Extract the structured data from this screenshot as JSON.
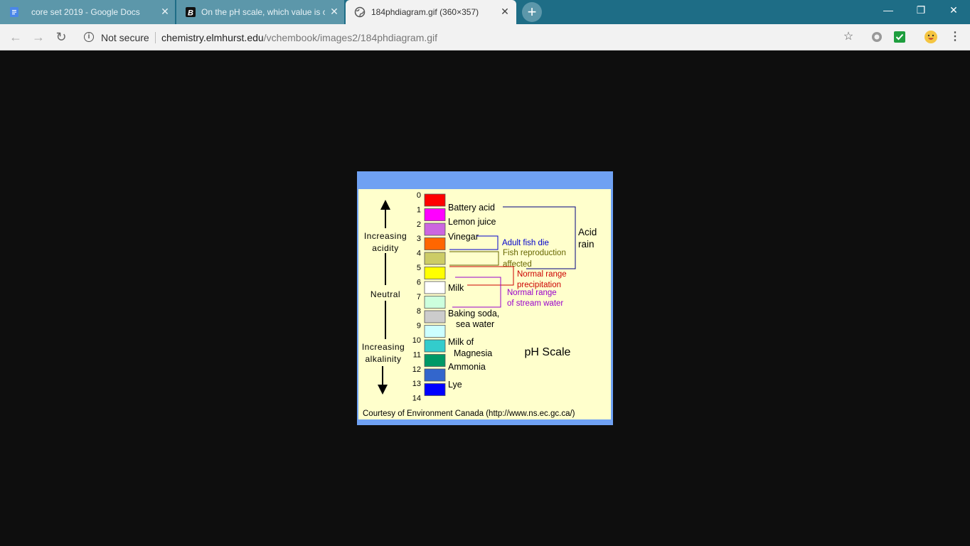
{
  "tabs": [
    {
      "title": "core set 2019 - Google Docs",
      "favicon": "google-docs-icon",
      "state": "background"
    },
    {
      "title": "On the pH scale, which value is c",
      "favicon": "brainly-icon",
      "state": "background"
    },
    {
      "title": "184phdiagram.gif (360×357)",
      "favicon": "globe-icon",
      "state": "active"
    }
  ],
  "toolbar": {
    "security_text": "Not secure",
    "url_host": "chemistry.elmhurst.edu",
    "url_path": "/vchembook/images2/184phdiagram.gif"
  },
  "diagram": {
    "title": "pH Scale",
    "ph_numbers": [
      "0",
      "1",
      "2",
      "3",
      "4",
      "5",
      "6",
      "7",
      "8",
      "9",
      "10",
      "11",
      "12",
      "13",
      "14"
    ],
    "swatch_colors": [
      "#ff0000",
      "#ff00ff",
      "#cc66e0",
      "#ff6600",
      "#cccc66",
      "#ffff00",
      "#ffffff",
      "#ccffdd",
      "#cccccc",
      "#ccffff",
      "#33cccc",
      "#009966",
      "#3366cc",
      "#0000ff"
    ],
    "substances": {
      "battery_acid": "Battery acid",
      "lemon_juice": "Lemon juice",
      "vinegar": "Vinegar",
      "milk": "Milk",
      "baking_soda_1": "Baking soda,",
      "baking_soda_2": "sea water",
      "milk_of_magnesia_1": "Milk of",
      "milk_of_magnesia_2": "Magnesia",
      "ammonia": "Ammonia",
      "lye": "Lye"
    },
    "axis_labels": {
      "acidity_1": "Increasing",
      "acidity_2": "acidity",
      "neutral": "Neutral",
      "alkalinity_1": "Increasing",
      "alkalinity_2": "alkalinity"
    },
    "ranges": {
      "acid_rain_1": "Acid",
      "acid_rain_2": "rain",
      "fish_die": "Adult fish die",
      "fish_repro_1": "Fish reproduction",
      "fish_repro_2": "affected",
      "precip_1": "Normal range",
      "precip_2": "precipitation",
      "stream_1": "Normal range",
      "stream_2": "of stream water"
    },
    "range_colors": {
      "acid_rain": "#000080",
      "fish_die": "#0000cc",
      "fish_repro": "#666600",
      "precip": "#cc0000",
      "stream": "#9900cc"
    },
    "credit": "Courtesy of Environment Canada (http://www.ns.ec.gc.ca/)"
  }
}
